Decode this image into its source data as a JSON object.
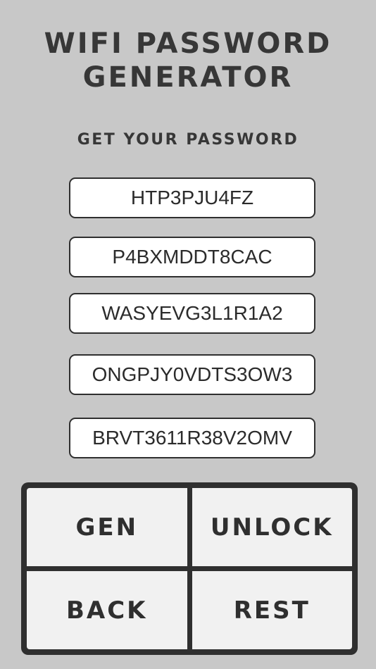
{
  "header": {
    "title_line1": "WIFI PASSWORD",
    "title_line2": "GENERATOR",
    "subtitle": "GET YOUR PASSWORD"
  },
  "passwords": [
    "HTP3PJU4FZ",
    "P4BXMDDT8CAC",
    "WASYEVG3L1R1A2",
    "ONGPJY0VDTS3OW3",
    "BRVT3611R38V2OMV"
  ],
  "buttons": {
    "gen": "GEN",
    "unlock": "UNLOCK",
    "back": "BACK",
    "rest": "REST"
  },
  "colors": {
    "background": "#c8c8c8",
    "text_dark": "#373737",
    "panel_border": "#2f2f2f",
    "button_bg": "#f1f1f1",
    "field_bg": "#ffffff"
  }
}
